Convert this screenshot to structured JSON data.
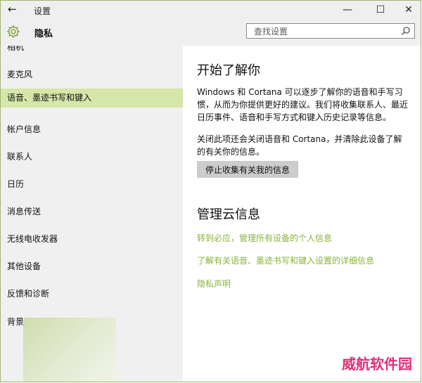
{
  "window": {
    "title": "设置",
    "back_glyph": "←",
    "minimize_glyph": "—",
    "maximize_glyph": "☐",
    "close_glyph": "✕"
  },
  "header": {
    "title": "隐私",
    "search_placeholder": "查找设置",
    "icon": "gear-icon"
  },
  "sidebar": {
    "items": [
      {
        "label": "相机"
      },
      {
        "label": "麦克风"
      },
      {
        "label": "语音、墨迹书写和键入"
      },
      {
        "label": "帐户信息"
      },
      {
        "label": "联系人"
      },
      {
        "label": "日历"
      },
      {
        "label": "消息传送"
      },
      {
        "label": "无线电收发器"
      },
      {
        "label": "其他设备"
      },
      {
        "label": "反馈和诊断"
      },
      {
        "label": "背景应用"
      }
    ],
    "selected_index": 2
  },
  "main": {
    "section1_title": "开始了解你",
    "para1": "Windows 和 Cortana 可以逐步了解你的语音和手写习惯，从而为你提供更好的建议。我们将收集联系人、最近日历事件、语音和手写方式和键入历史记录等信息。",
    "para2": "关闭此项还会关闭语音和 Cortana，并清除此设备了解的有关你的信息。",
    "button_label": "停止收集有关我的信息",
    "section2_title": "管理云信息",
    "links": [
      "转到必应，管理所有设备的个人信息",
      "了解有关语音、墨迹书写和键入设置的详细信息",
      "隐私声明"
    ]
  },
  "watermark": "威航软件园",
  "colors": {
    "accent": "#8ab33c",
    "selected_bg": "#d5e6a8",
    "button_bg": "#cccccc"
  }
}
